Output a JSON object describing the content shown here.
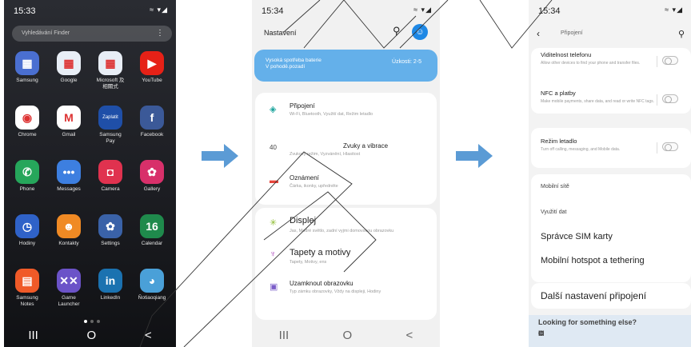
{
  "phone1": {
    "time": "15:33",
    "signal": "≈ ▾◢",
    "search_placeholder": "Vyhledávání Finder",
    "apps": [
      {
        "label": "Samsung",
        "icon": "samsung-folder-icon",
        "color": "#4a6fd1",
        "glyph": "▦"
      },
      {
        "label": "Google",
        "icon": "google-folder-icon",
        "color": "#e8eef6",
        "glyph": "▦"
      },
      {
        "label": "Microsoft 及\n相關式",
        "icon": "microsoft-folder-icon",
        "color": "#e8eef6",
        "glyph": "▦"
      },
      {
        "label": "YouTube",
        "icon": "youtube-icon",
        "color": "#e62117",
        "glyph": "▶"
      },
      {
        "label": "Chrome",
        "icon": "chrome-icon",
        "color": "#ffffff",
        "glyph": "◉"
      },
      {
        "label": "Gmail",
        "icon": "gmail-icon",
        "color": "#ffffff",
        "glyph": "M"
      },
      {
        "label": "Samsung\nPay",
        "icon": "samsung-pay-icon",
        "color": "#1f4fa8",
        "glyph": "Zaplatit"
      },
      {
        "label": "Facebook",
        "icon": "facebook-icon",
        "color": "#3b5998",
        "glyph": "f"
      },
      {
        "label": "Phone",
        "icon": "phone-icon",
        "color": "#26a65b",
        "glyph": "✆"
      },
      {
        "label": "Messages",
        "icon": "messages-icon",
        "color": "#3d7fe0",
        "glyph": "•••"
      },
      {
        "label": "Camera",
        "icon": "camera-icon",
        "color": "#e0324f",
        "glyph": "◘"
      },
      {
        "label": "Gallery",
        "icon": "gallery-icon",
        "color": "#d8306a",
        "glyph": "✿"
      },
      {
        "label": "Hodiny",
        "icon": "clock-icon",
        "color": "#2f62c8",
        "glyph": "◷"
      },
      {
        "label": "Kontakty",
        "icon": "contacts-icon",
        "color": "#f08a24",
        "glyph": "☻"
      },
      {
        "label": "Settings",
        "icon": "settings-icon",
        "color": "#3a62a8",
        "glyph": "✿"
      },
      {
        "label": "Calendar",
        "icon": "calendar-icon",
        "color": "#1f8a4c",
        "glyph": "16"
      },
      {
        "label": "Samsung\nNotes",
        "icon": "samsung-notes-icon",
        "color": "#f05a28",
        "glyph": "▤"
      },
      {
        "label": "Game\nLauncher",
        "icon": "game-launcher-icon",
        "color": "#6b53c8",
        "glyph": "✕✕"
      },
      {
        "label": "LinkedIn",
        "icon": "linkedin-icon",
        "color": "#1b72b0",
        "glyph": "in"
      },
      {
        "label": "Ñotiaoqiang",
        "icon": "app-icon",
        "color": "#4aa0d8",
        "glyph": "◕"
      }
    ],
    "nav": [
      "III",
      "O",
      "<"
    ]
  },
  "phone2": {
    "time": "15:34",
    "signal": "≈ ▾◢",
    "title": "Nastavení",
    "battery_title": "Vysoká spotřeba baterie",
    "battery_sub": "V pohodě.pozadí",
    "battery_right": "Úzkosti: 2-5",
    "rows": [
      {
        "icon": "wifi-icon",
        "glyph": "◈",
        "color": "#1ba39c",
        "title": "Připojení",
        "sub": "Wi-Fi, Bluetooth, Využití dat, Režim letadlo"
      },
      {
        "icon": "volume-icon",
        "glyph": "40",
        "color": "#444",
        "title": "Zvuky a vibrace",
        "sub": "Zvukový režim, Vyzvánění, Hlasitost"
      },
      {
        "icon": "notification-icon",
        "glyph": "▬",
        "color": "#e8453c",
        "title": "Oznámení",
        "sub": "Čárka, ikonky, upředněte"
      },
      {
        "icon": "brightness-icon",
        "glyph": "✳",
        "color": "#8dbb2e",
        "title": "Displej",
        "sub": "Jas, Modré světlo, zadní vyjmi domovskou obrazovku"
      },
      {
        "icon": "brush-icon",
        "glyph": "♆",
        "color": "#b050c0",
        "title": "Tapety a motivy",
        "sub": "Tapety, Motivy, ens"
      },
      {
        "icon": "lock-screen-icon",
        "glyph": "▣",
        "color": "#7a5cc8",
        "title": "Uzamknout obrazovku",
        "sub": "Typ zámku obrazovky, Vždy na displeji, Hodiny"
      }
    ],
    "nav": [
      "III",
      "O",
      "<"
    ]
  },
  "phone3": {
    "time": "15:34",
    "signal": "≈ ▾◢",
    "back_label": "Připojení",
    "toggle_rows": [
      {
        "title": "Viditelnost telefonu",
        "sub": "Allow other devices to find your phone and transfer files."
      },
      {
        "title": "NFC a platby",
        "sub": "Make mobile payments, share data, and read or write NFC tags."
      },
      {
        "title": "Režim letadlo",
        "sub": "Turn off calling, messaging, and Mobile data."
      }
    ],
    "items": [
      "Mobilní sítě",
      "Využití dat",
      "Správce SIM karty",
      "Mobilní hotspot a tethering",
      "Další nastavení připojení"
    ],
    "looking": "Looking for something else?",
    "nav": [
      "III",
      "O",
      "<"
    ]
  },
  "colors": {
    "arrow": "#5b9bd5"
  }
}
